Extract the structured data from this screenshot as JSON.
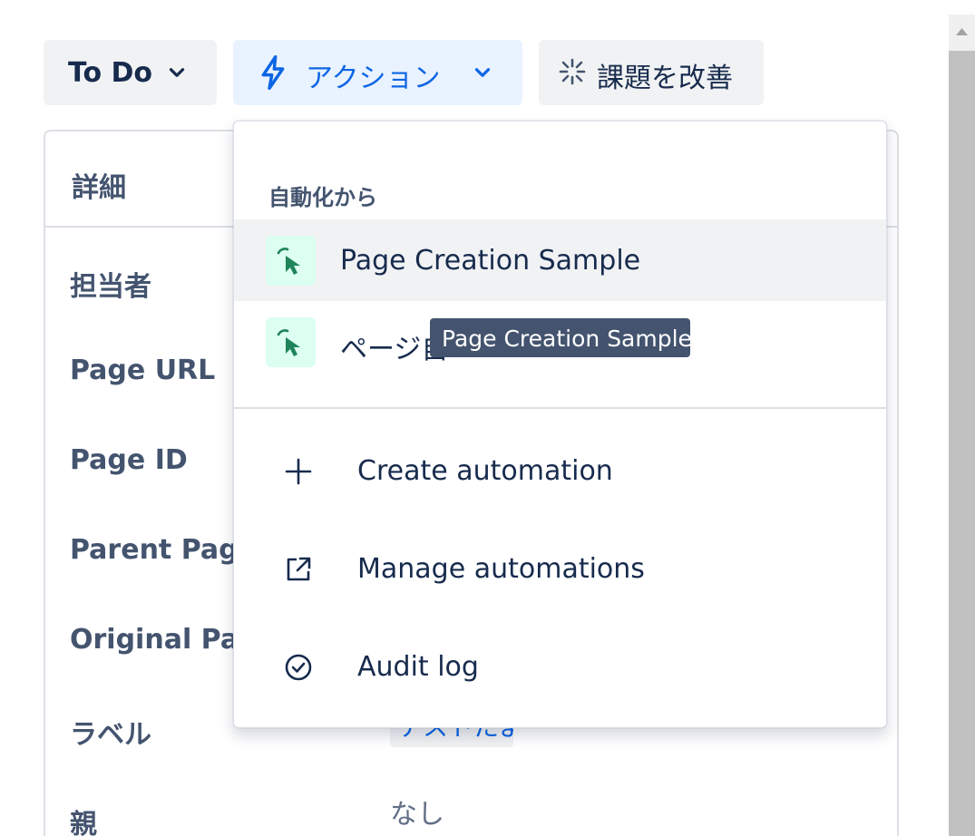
{
  "toolbar": {
    "status_label": "To Do",
    "action_label": "アクション",
    "improve_label": "課題を改善"
  },
  "details": {
    "title": "詳細",
    "fields": [
      {
        "label": "担当者"
      },
      {
        "label": "Page URL"
      },
      {
        "label": "Page ID"
      },
      {
        "label": "Parent Page I"
      },
      {
        "label": "Original Page"
      },
      {
        "label": "ラベル",
        "value": "テストたよ"
      },
      {
        "label": "親",
        "value": "なし"
      }
    ]
  },
  "menu": {
    "section_title": "自動化から",
    "rules": [
      {
        "label": "Page Creation Sample",
        "icon": "cursor-click-icon"
      },
      {
        "label": "ページ自",
        "icon": "cursor-click-icon"
      }
    ],
    "items": [
      {
        "label": "Create automation",
        "icon": "plus-icon"
      },
      {
        "label": "Manage automations",
        "icon": "external-link-icon"
      },
      {
        "label": "Audit log",
        "icon": "check-circle-icon"
      }
    ]
  },
  "tooltip": {
    "text": "Page Creation Sample"
  },
  "colors": {
    "accent": "#0c66e4",
    "action_bg": "#e9f2ff",
    "neutral_bg": "#f1f2f4",
    "rule_icon_bg": "#dcfff1",
    "rule_icon_fg": "#1f845a",
    "tooltip_bg": "#44546f"
  }
}
